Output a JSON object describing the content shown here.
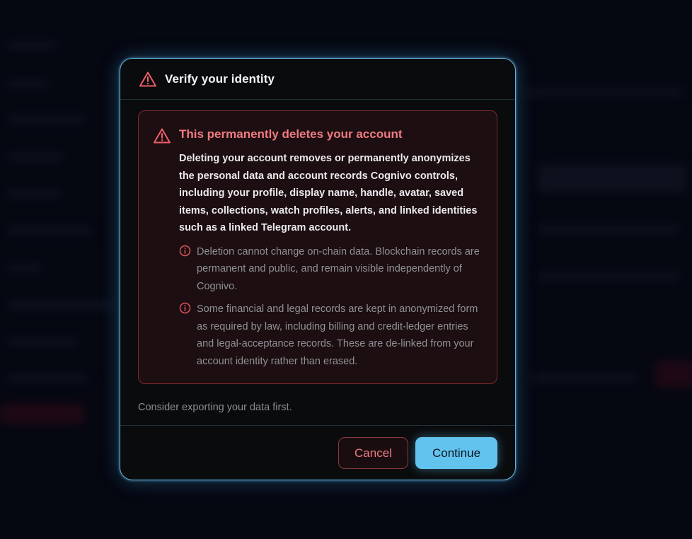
{
  "dialog": {
    "title": "Verify your identity",
    "header_icon": "warning-triangle-icon"
  },
  "warning": {
    "icon": "warning-triangle-icon",
    "title": "This permanently deletes your account",
    "body": "Deleting your account removes or permanently anonymizes the personal data and account records Cognivo controls, including your profile, display name, handle, avatar, saved items, collections, watch profiles, alerts, and linked identities such as a linked Telegram account.",
    "notes": [
      {
        "icon": "info-circle-icon",
        "text": "Deletion cannot change on-chain data. Blockchain records are permanent and public, and remain visible independently of Cognivo."
      },
      {
        "icon": "info-circle-icon",
        "text": "Some financial and legal records are kept in anonymized form as required by law, including billing and credit-ledger entries and legal-acceptance records. These are de-linked from your account identity rather than erased."
      }
    ]
  },
  "hint": "Consider exporting your data first.",
  "footer": {
    "cancel_label": "Cancel",
    "continue_label": "Continue"
  },
  "colors": {
    "accent": "#62c3ee",
    "danger": "#f07b82",
    "danger_border": "#7e2a30",
    "modal_bg": "#0a0b0d"
  }
}
